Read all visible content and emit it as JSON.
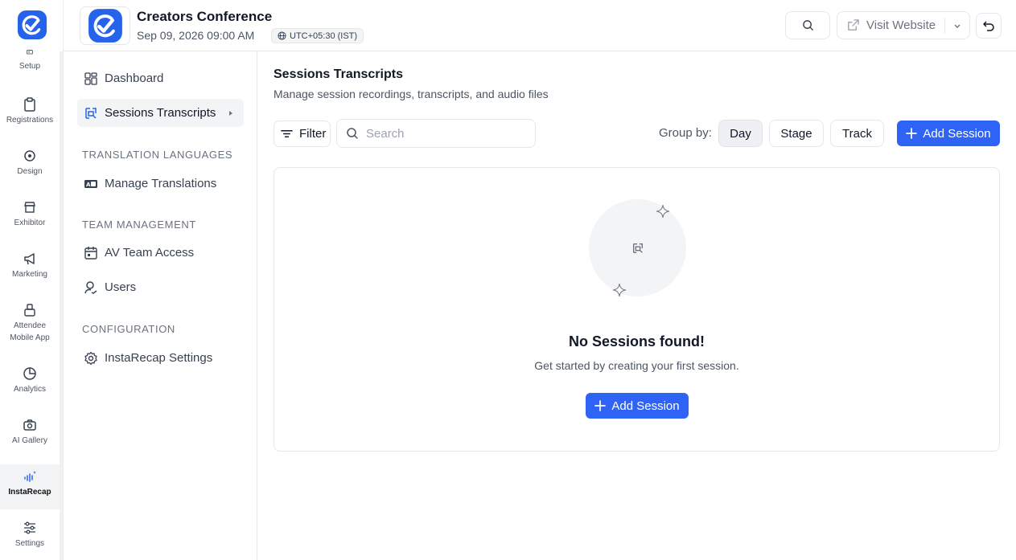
{
  "header": {
    "event_title": "Creators Conference",
    "event_date": "Sep 09, 2026 09:00 AM",
    "timezone": "UTC+05:30 (IST)",
    "visit_label": "Visit Website"
  },
  "rail": {
    "items": [
      {
        "label": "Setup",
        "icon": "setup-icon"
      },
      {
        "label": "Registrations",
        "icon": "clipboard-icon"
      },
      {
        "label": "Design",
        "icon": "design-icon"
      },
      {
        "label": "Exhibitor",
        "icon": "storefront-icon"
      },
      {
        "label": "Marketing",
        "icon": "megaphone-icon"
      },
      {
        "label": "Attendee",
        "label2": "Mobile App",
        "icon": "mobile-app-icon"
      },
      {
        "label": "Analytics",
        "icon": "pie-chart-icon"
      },
      {
        "label": "AI Gallery",
        "icon": "camera-icon"
      },
      {
        "label": "InstaRecap",
        "icon": "instarecap-icon",
        "active": true
      },
      {
        "label": "Settings",
        "icon": "sliders-icon"
      }
    ]
  },
  "subnav": {
    "dashboard": "Dashboard",
    "sessions_transcripts": "Sessions Transcripts",
    "section_translation": "TRANSLATION LANGUAGES",
    "manage_translations": "Manage Translations",
    "section_team": "TEAM MANAGEMENT",
    "av_team_access": "AV Team Access",
    "users": "Users",
    "section_config": "CONFIGURATION",
    "instarecap_settings": "InstaRecap Settings"
  },
  "main": {
    "title": "Sessions Transcripts",
    "subtitle": "Manage session recordings, transcripts, and audio files",
    "filter_label": "Filter",
    "search_placeholder": "Search",
    "group_by_label": "Group by:",
    "group_options": [
      "Day",
      "Stage",
      "Track"
    ],
    "group_selected": "Day",
    "add_session_label": "Add Session",
    "empty_title": "No Sessions found!",
    "empty_subtitle": "Get started by creating your first session.",
    "empty_add_label": "Add Session"
  },
  "colors": {
    "primary": "#2f63f6",
    "logo_blue": "#2563eb"
  }
}
